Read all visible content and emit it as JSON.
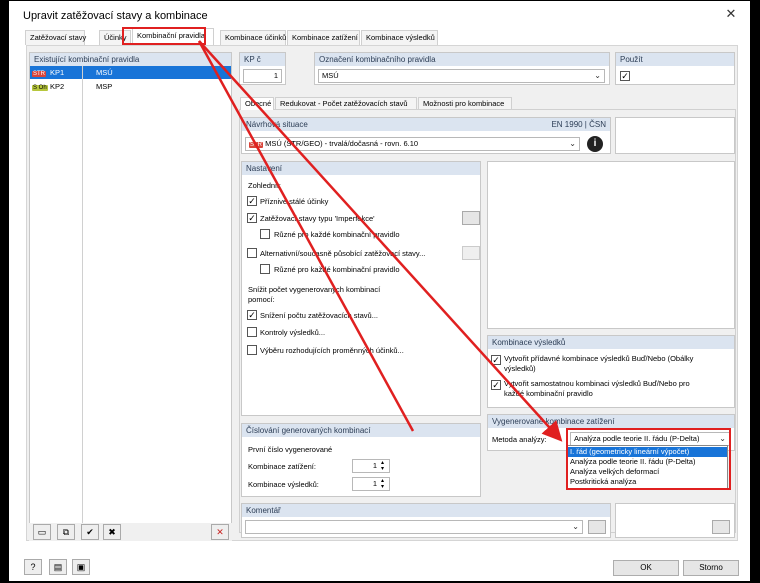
{
  "window": {
    "title": "Upravit zatěžovací stavy a kombinace",
    "close_glyph": "✕"
  },
  "tabs": [
    "Zatěžovací stavy",
    "Účinky",
    "Kombinační pravidla",
    "Kombinace účinků",
    "Kombinace zatížení",
    "Kombinace výsledků"
  ],
  "rules_panel": {
    "header": "Existující kombinační pravidla",
    "rows": [
      {
        "tag": "STR",
        "id": "KP1",
        "name": "MSÚ"
      },
      {
        "tag": "S Oh",
        "id": "KP2",
        "name": "MSP"
      }
    ]
  },
  "top_fields": {
    "kp_label": "KP č",
    "kp_value": "1",
    "name_label": "Označení kombinačního pravidla",
    "name_value": "MSÚ",
    "use_label": "Použít"
  },
  "subtabs": [
    "Obecné",
    "Redukovat - Počet zatěžovacích stavů",
    "Možnosti pro kombinace"
  ],
  "design_situation": {
    "header": "Návrhová situace",
    "norm": "EN 1990 | ČSN",
    "tag": "STR",
    "value": "MSÚ (STR/GEO) - trvalá/dočasná - rovn. 6.10"
  },
  "settings": {
    "header": "Nastavení",
    "consider_label": "Zohlednit:",
    "items": {
      "favorable": "Příznivé stálé účinky",
      "imperfection": "Zatěžovací stavy typu 'Imperfekce'",
      "imperfection_each": "Různé pro každé kombinační pravidlo",
      "alternative": "Alternativní/současně působící zatěžovací stavy...",
      "alternative_each": "Různé pro každé kombinační pravidlo"
    },
    "reduce_label": "Snížit počet vygenerovaných kombinací pomocí:",
    "reduce_items": {
      "reduce_lc": "Snížení počtu zatěžovacích stavů...",
      "check_results": "Kontroly výsledků...",
      "select_actions": "Výběru rozhodujících proměnných účinků..."
    }
  },
  "numbering": {
    "header": "Číslování generovaných kombinací",
    "first_label": "První číslo vygenerované",
    "load_combo_label": "Kombinace zatížení:",
    "load_combo_value": "1",
    "result_combo_label": "Kombinace výsledků:",
    "result_combo_value": "1"
  },
  "result_combos": {
    "header": "Kombinace výsledků",
    "opt1": "Vytvořit přídavné kombinace výsledků Buď/Nebo (Obálky výsledků)",
    "opt2": "Vytvořit samostatnou kombinaci výsledků Buď/Nebo pro každé kombinační pravidlo"
  },
  "generated_load_combos": {
    "header": "Vygenerované kombinace zatížení",
    "method_label": "Metoda analýzy:",
    "method_value": "Analýza podle teorie II. řádu (P-Delta)",
    "options": [
      "I. řád (geometricky lineární výpočet)",
      "Analýza podle teorie II. řádu (P-Delta)",
      "Analýza velkých deformací",
      "Postkritická analýza"
    ]
  },
  "comment": {
    "header": "Komentář",
    "value": ""
  },
  "buttons": {
    "ok": "OK",
    "cancel": "Storno"
  },
  "colors": {
    "accent": "#1874d8",
    "annotation_red": "#e02020",
    "header_blue": "#dbe4f0"
  },
  "icons": {
    "dropdown": "chevron-down-icon",
    "info": "info-icon",
    "delete": "delete-icon",
    "help": "help-icon"
  }
}
